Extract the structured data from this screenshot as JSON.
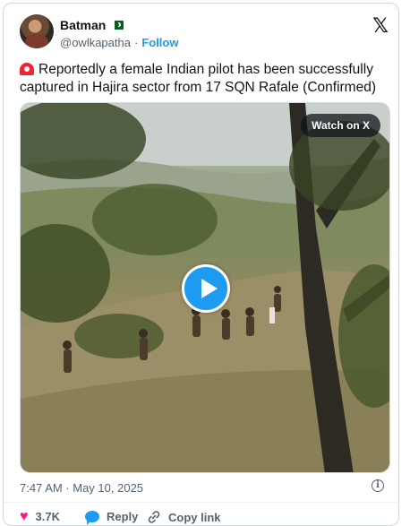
{
  "author": {
    "name": "Batman",
    "handle": "@owlkapatha",
    "separator": "·",
    "follow_label": "Follow"
  },
  "tweet": {
    "text": "Reportedly a female Indian pilot has been successfully captured in Hajira sector from 17 SQN Rafale (Confirmed)"
  },
  "media": {
    "watch_label": "Watch on X"
  },
  "meta": {
    "timestamp": "7:47 AM · May 10, 2025",
    "info_glyph": "i"
  },
  "actions": {
    "like_count": "3.7K",
    "reply_label": "Reply",
    "copy_label": "Copy link"
  },
  "colors": {
    "accent": "#1d9bf0",
    "like": "#f91880",
    "text": "#0f1419",
    "muted": "#536471"
  },
  "icons": {
    "brand": "x-logo-icon",
    "flag": "pakistan-flag-icon",
    "siren": "siren-emoji-icon",
    "play": "play-icon",
    "info": "info-icon",
    "like": "heart-icon",
    "reply": "reply-bubble-icon",
    "copy": "link-icon"
  }
}
